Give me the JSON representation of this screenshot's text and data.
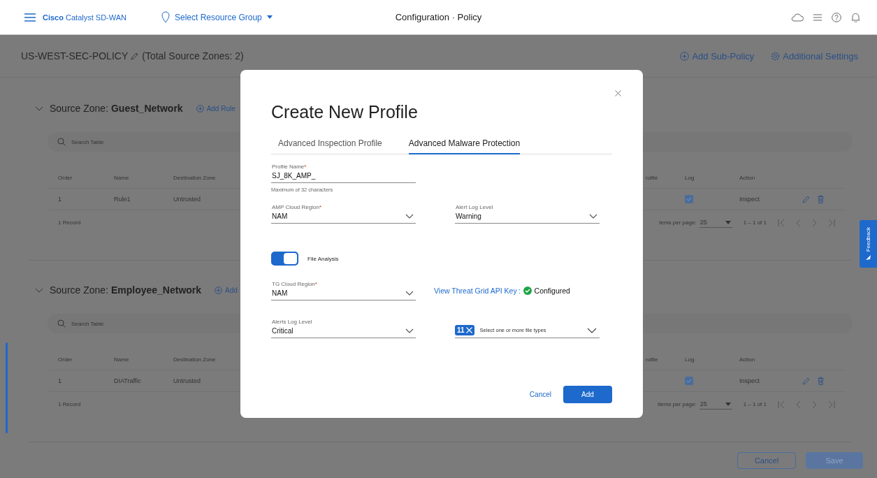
{
  "top_bar": {
    "product": "**Cisco** Catalyst SD-WAN",
    "resource_group": "Select Resource Group",
    "title": "Configuration · Policy"
  },
  "policy_header": {
    "name": "US-WEST-SEC-POLICY",
    "summary": "(Total Source Zones: 2)",
    "add_sub_policy": "Add Sub-Policy",
    "additional_settings": "Additional Settings"
  },
  "zones": [
    {
      "heading": "Source Zone: **Guest_Network**",
      "expanded": true,
      "add_rule": "Add Rule",
      "search_placeholder": "Search Table",
      "columns_left": [
        "Order",
        "Name",
        "Destination Zone"
      ],
      "columns_right": [
        "rofile",
        "Log",
        "Action"
      ],
      "rows": [
        {
          "order": "1",
          "name": "Rule1",
          "destination": "Untrusted",
          "log": true,
          "action": "Inspect"
        }
      ],
      "record_count": "1 Record",
      "items_per_page_label": "tems per page:",
      "items_per_page": "25",
      "range": "1 – 1 of 1"
    },
    {
      "heading": "Source Zone: **Employee_Network**",
      "expanded": true,
      "add_rule": "Add",
      "search_placeholder": "Search Table",
      "columns_left": [
        "Order",
        "Name",
        "Destination Zone"
      ],
      "columns_right": [
        "rofile",
        "Log",
        "Action"
      ],
      "rows": [
        {
          "order": "1",
          "name": "DIATraffic",
          "destination": "Untrusted",
          "log": true,
          "action": "Inspect"
        }
      ],
      "record_count": "1 Record",
      "items_per_page_label": "Items per page:",
      "items_per_page": "25",
      "range": "1 – 1 of 1"
    }
  ],
  "footer_buttons": {
    "cancel": "Cancel",
    "save": "Save",
    "save_disabled": true
  },
  "feedback_tab": "Feedback",
  "modal": {
    "title": "Create New Profile",
    "tabs": [
      {
        "label": "Advanced Inspection Profile",
        "selected": false
      },
      {
        "label": "Advanced Malware Protection",
        "selected": true
      }
    ],
    "profile_name": {
      "label": "Profile Name",
      "required_mark": "*",
      "value": "SJ_8K_AMP_",
      "helper": "Maximum of 32 characters"
    },
    "amp_cloud_region": {
      "label": "AMP Cloud Region",
      "required_mark": "*",
      "value": "NAM"
    },
    "alert_log_level": {
      "label": "Alert Log Level",
      "value": "Warning"
    },
    "file_analysis": {
      "label": "File Analysis",
      "on": true
    },
    "tg_cloud_region": {
      "label": "TG Cloud Region",
      "required_mark": "*",
      "value": "NAM"
    },
    "api_key": {
      "link": "View Threat Grid API Key",
      "separator": ":",
      "status": "Configured"
    },
    "alerts_log_level": {
      "label": "Alerts Log Level",
      "value": "Critical"
    },
    "file_types": {
      "count": "11",
      "placeholder": "Select one or more file types"
    },
    "buttons": {
      "cancel": "Cancel",
      "add": "Add"
    }
  }
}
